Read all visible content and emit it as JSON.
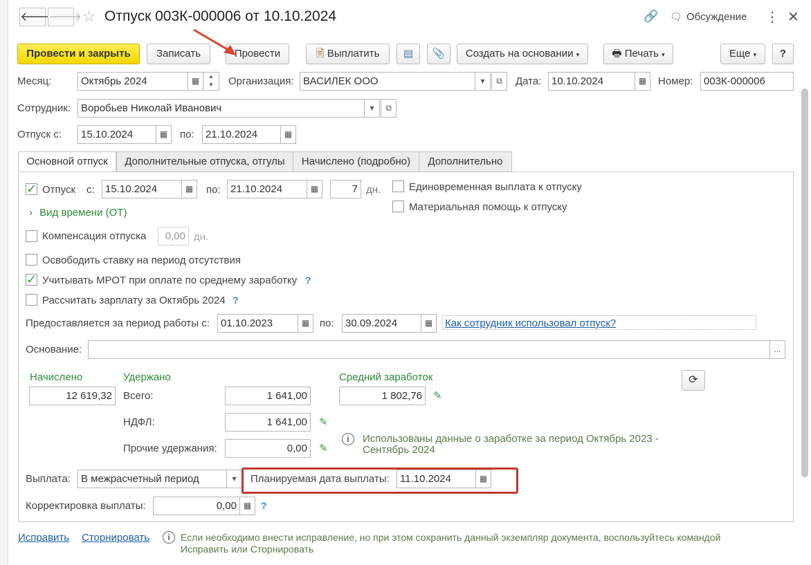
{
  "window": {
    "title": "Отпуск 003К-000006 от 10.10.2024",
    "back": "🡐",
    "forward": "🡒",
    "discussion": "Обсуждение"
  },
  "toolbar": {
    "post_close": "Провести и закрыть",
    "save": "Записать",
    "post": "Провести",
    "pay": "Выплатить",
    "create_based": "Создать на основании",
    "print": "Печать",
    "more": "Еще",
    "help": "?"
  },
  "header": {
    "month_label": "Месяц:",
    "month_value": "Октябрь 2024",
    "org_label": "Организация:",
    "org_value": "ВАСИЛЕК ООО",
    "date_label": "Дата:",
    "date_value": "10.10.2024",
    "number_label": "Номер:",
    "number_value": "003К-000006",
    "employee_label": "Сотрудник:",
    "employee_value": "Воробьев Николай Иванович",
    "vacation_from_label": "Отпуск с:",
    "vacation_from_value": "15.10.2024",
    "vacation_to_label": "по:",
    "vacation_to_value": "21.10.2024"
  },
  "tabs": [
    {
      "label": "Основной отпуск",
      "active": true
    },
    {
      "label": "Дополнительные отпуска, отгулы",
      "active": false
    },
    {
      "label": "Начислено (подробно)",
      "active": false
    },
    {
      "label": "Дополнительно",
      "active": false
    }
  ],
  "main": {
    "vacation_label": "Отпуск",
    "vacation_checked": true,
    "from_label": "с:",
    "from_value": "15.10.2024",
    "to_label": "по:",
    "to_value": "21.10.2024",
    "days_value": "7",
    "days_unit": "дн.",
    "lump_sum_label": "Единовременная выплата к отпуску",
    "material_aid_label": "Материальная помощь к отпуску",
    "time_type_label": "Вид времени (ОТ)",
    "compensation_label": "Компенсация отпуска",
    "compensation_value": "0,00",
    "compensation_unit": "дн.",
    "free_rate_label": "Освободить ставку на период отсутствия",
    "mrot_label": "Учитывать МРОТ при оплате по среднему заработку",
    "mrot_checked": true,
    "calc_salary_label": "Рассчитать зарплату за Октябрь 2024",
    "work_period_label": "Предоставляется за период работы с:",
    "work_period_from": "01.10.2023",
    "work_period_to_label": "по:",
    "work_period_to": "30.09.2024",
    "usage_link": "Как сотрудник использовал отпуск?",
    "basis_label": "Основание:",
    "basis_value": "",
    "basis_btn": "...",
    "accrued_label": "Начислено",
    "accrued_value": "12 619,32",
    "withheld_label": "Удержано",
    "total_label": "Всего:",
    "total_value": "1 641,00",
    "ndfl_label": "НДФЛ:",
    "ndfl_value": "1 641,00",
    "other_label": "Прочие удержания:",
    "other_value": "0,00",
    "avg_label": "Средний заработок",
    "avg_value": "1 802,76",
    "info_text_line1": "Использованы данные о заработке за период Октябрь 2023 -",
    "info_text_line2": "Сентябрь 2024",
    "payment_label": "Выплата:",
    "payment_value": "В межрасчетный период",
    "planned_date_label": "Планируемая дата выплаты:",
    "planned_date_value": "11.10.2024",
    "correction_label": "Корректировка выплаты:",
    "correction_value": "0,00"
  },
  "footer": {
    "fix_link": "Исправить",
    "reverse_link": "Сторнировать",
    "note_line1": "Если необходимо внести исправление, но при этом сохранить данный экземпляр документа, воспользуйтесь командой",
    "note_line2": "Исправить или Сторнировать"
  },
  "colors": {
    "accent_yellow": "#f5d800",
    "green_text": "#2e8b3a",
    "link_blue": "#1f5fa8",
    "highlight_red": "#c0392b"
  }
}
